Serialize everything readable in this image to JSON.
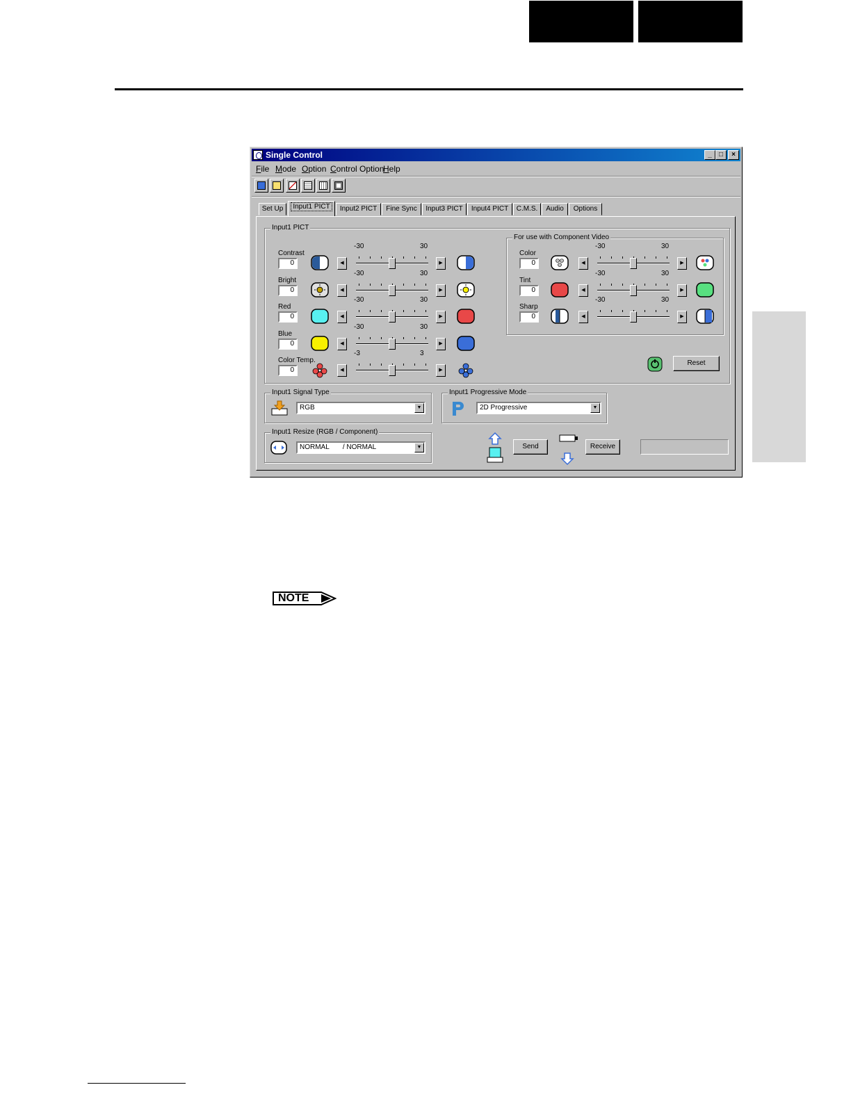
{
  "window": {
    "title": "Single Control",
    "controls": [
      "_",
      "□",
      "×"
    ]
  },
  "menu": [
    {
      "label": "File",
      "u": "F",
      "rest": "ile"
    },
    {
      "label": "Mode",
      "u": "M",
      "rest": "ode"
    },
    {
      "label": "Option",
      "u": "O",
      "rest": "ption"
    },
    {
      "label": "Control Option",
      "u": "C",
      "rest": "ontrol Option"
    },
    {
      "label": "Help",
      "u": "H",
      "rest": "elp"
    }
  ],
  "toolbar_icons": [
    "open-icon",
    "save-icon",
    "delete-icon",
    "list-icon",
    "grid-icon",
    "layout-icon"
  ],
  "tabs": [
    "Set Up",
    "Input1 PICT",
    "Input2 PICT",
    "Fine Sync",
    "Input3 PICT",
    "Input4 PICT",
    "C.M.S.",
    "Audio",
    "Options"
  ],
  "active_tab": "Input1 PICT",
  "picture_group": {
    "label": "Input1 PICT",
    "controls": [
      {
        "label": "Contrast",
        "value": "0",
        "min_label": "-30",
        "max_label": "30",
        "min": -30,
        "max": 30,
        "pos": 0
      },
      {
        "label": "Bright",
        "value": "0",
        "min_label": "-30",
        "max_label": "30",
        "min": -30,
        "max": 30,
        "pos": 0
      },
      {
        "label": "Red",
        "value": "0",
        "min_label": "-30",
        "max_label": "30",
        "min": -30,
        "max": 30,
        "pos": 0
      },
      {
        "label": "Blue",
        "value": "0",
        "min_label": "-30",
        "max_label": "30",
        "min": -30,
        "max": 30,
        "pos": 0
      },
      {
        "label": "Color Temp.",
        "value": "0",
        "min_label": "-3",
        "max_label": "3",
        "min": -3,
        "max": 3,
        "pos": 0
      }
    ]
  },
  "component_group": {
    "label": "For use with Component Video",
    "controls": [
      {
        "label": "Color",
        "value": "0",
        "min_label": "-30",
        "max_label": "30",
        "min": -30,
        "max": 30,
        "pos": 0
      },
      {
        "label": "Tint",
        "value": "0",
        "min_label": "-30",
        "max_label": "30",
        "min": -30,
        "max": 30,
        "pos": 0
      },
      {
        "label": "Sharp",
        "value": "0",
        "min_label": "-30",
        "max_label": "30",
        "min": -30,
        "max": 30,
        "pos": 0
      }
    ]
  },
  "reset_label": "Reset",
  "signal_type": {
    "label": "Input1 Signal Type",
    "value": "RGB"
  },
  "progressive": {
    "label": "Input1 Progressive Mode",
    "value": "2D Progressive"
  },
  "resize": {
    "label": "Input1 Resize (RGB / Component)",
    "value": "NORMAL       / NORMAL"
  },
  "send_label": "Send",
  "receive_label": "Receive",
  "note_label": "NOTE",
  "colors": {
    "accent_blue": "#3a6ed8",
    "red": "#e84848",
    "cyan": "#58f0f0",
    "yellow": "#f8f000",
    "green": "#58e080"
  }
}
